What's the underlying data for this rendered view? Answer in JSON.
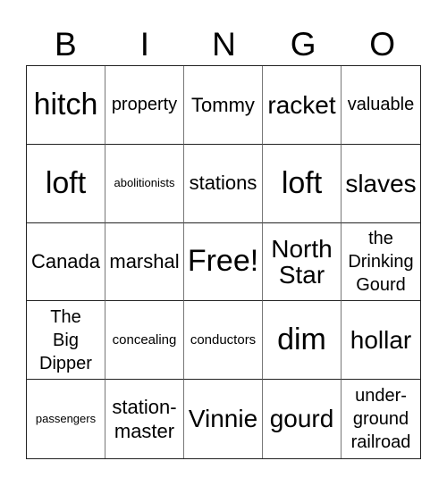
{
  "header": [
    "B",
    "I",
    "N",
    "G",
    "O"
  ],
  "cells": [
    {
      "text": "hitch",
      "size": "s-xl"
    },
    {
      "text": "property",
      "size": "s-sm"
    },
    {
      "text": "Tommy",
      "size": "s-md"
    },
    {
      "text": "racket",
      "size": "s-lg"
    },
    {
      "text": "valuable",
      "size": "s-sm"
    },
    {
      "text": "loft",
      "size": "s-xl"
    },
    {
      "text": "abolitionists",
      "size": "s-xxs"
    },
    {
      "text": "stations",
      "size": "s-md"
    },
    {
      "text": "loft",
      "size": "s-xl"
    },
    {
      "text": "slaves",
      "size": "s-lg"
    },
    {
      "text": "Canada",
      "size": "s-md"
    },
    {
      "text": "marshal",
      "size": "s-md"
    },
    {
      "text": "Free!",
      "size": "s-xl"
    },
    {
      "text": "North\nStar",
      "size": "s-lg"
    },
    {
      "text": "the\nDrinking\nGourd",
      "size": "s-sm"
    },
    {
      "text": "The\nBig\nDipper",
      "size": "s-sm"
    },
    {
      "text": "concealing",
      "size": "s-xs"
    },
    {
      "text": "conductors",
      "size": "s-xs"
    },
    {
      "text": "dim",
      "size": "s-xl"
    },
    {
      "text": "hollar",
      "size": "s-lg"
    },
    {
      "text": "passengers",
      "size": "s-xxs"
    },
    {
      "text": "station-\nmaster",
      "size": "s-md"
    },
    {
      "text": "Vinnie",
      "size": "s-lg"
    },
    {
      "text": "gourd",
      "size": "s-lg"
    },
    {
      "text": "under-\nground\nrailroad",
      "size": "s-sm"
    }
  ]
}
